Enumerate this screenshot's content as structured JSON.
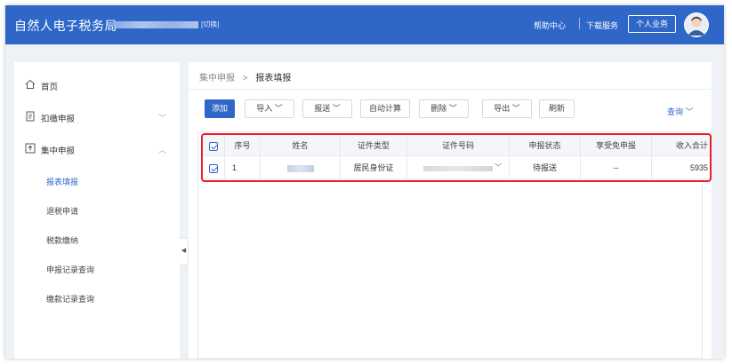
{
  "header": {
    "brand": "自然人电子税务局",
    "switch_label": "[切换]",
    "help": "帮助中心",
    "download": "下载服务",
    "personal": "个人业务"
  },
  "sidebar": {
    "home": "首页",
    "withholding": "扣缴申报",
    "centralized": "集中申报",
    "sub_items": [
      "报表填报",
      "退税申请",
      "税款缴纳",
      "申报记录查询",
      "缴款记录查询"
    ]
  },
  "breadcrumb": {
    "parent": "集中申报",
    "separator": ">",
    "current": "报表填报"
  },
  "toolbar": {
    "add": "添加",
    "import": "导入",
    "submit": "报送",
    "auto_calc": "自动计算",
    "delete": "删除",
    "export": "导出",
    "refresh": "刷新",
    "query": "查询"
  },
  "table": {
    "headers": [
      "序号",
      "姓名",
      "证件类型",
      "证件号码",
      "申报状态",
      "享受免申报",
      "收入合计"
    ],
    "rows": [
      {
        "index": "1",
        "id_type": "居民身份证",
        "status": "待报送",
        "exempt": "--",
        "income": "5935"
      }
    ]
  },
  "icons": {
    "home": "home-icon",
    "withholding": "document-icon",
    "centralized": "upload-box-icon",
    "chevron": "chevron-down-icon"
  },
  "colors": {
    "primary": "#2f67c9",
    "highlight": "#e8202b"
  }
}
